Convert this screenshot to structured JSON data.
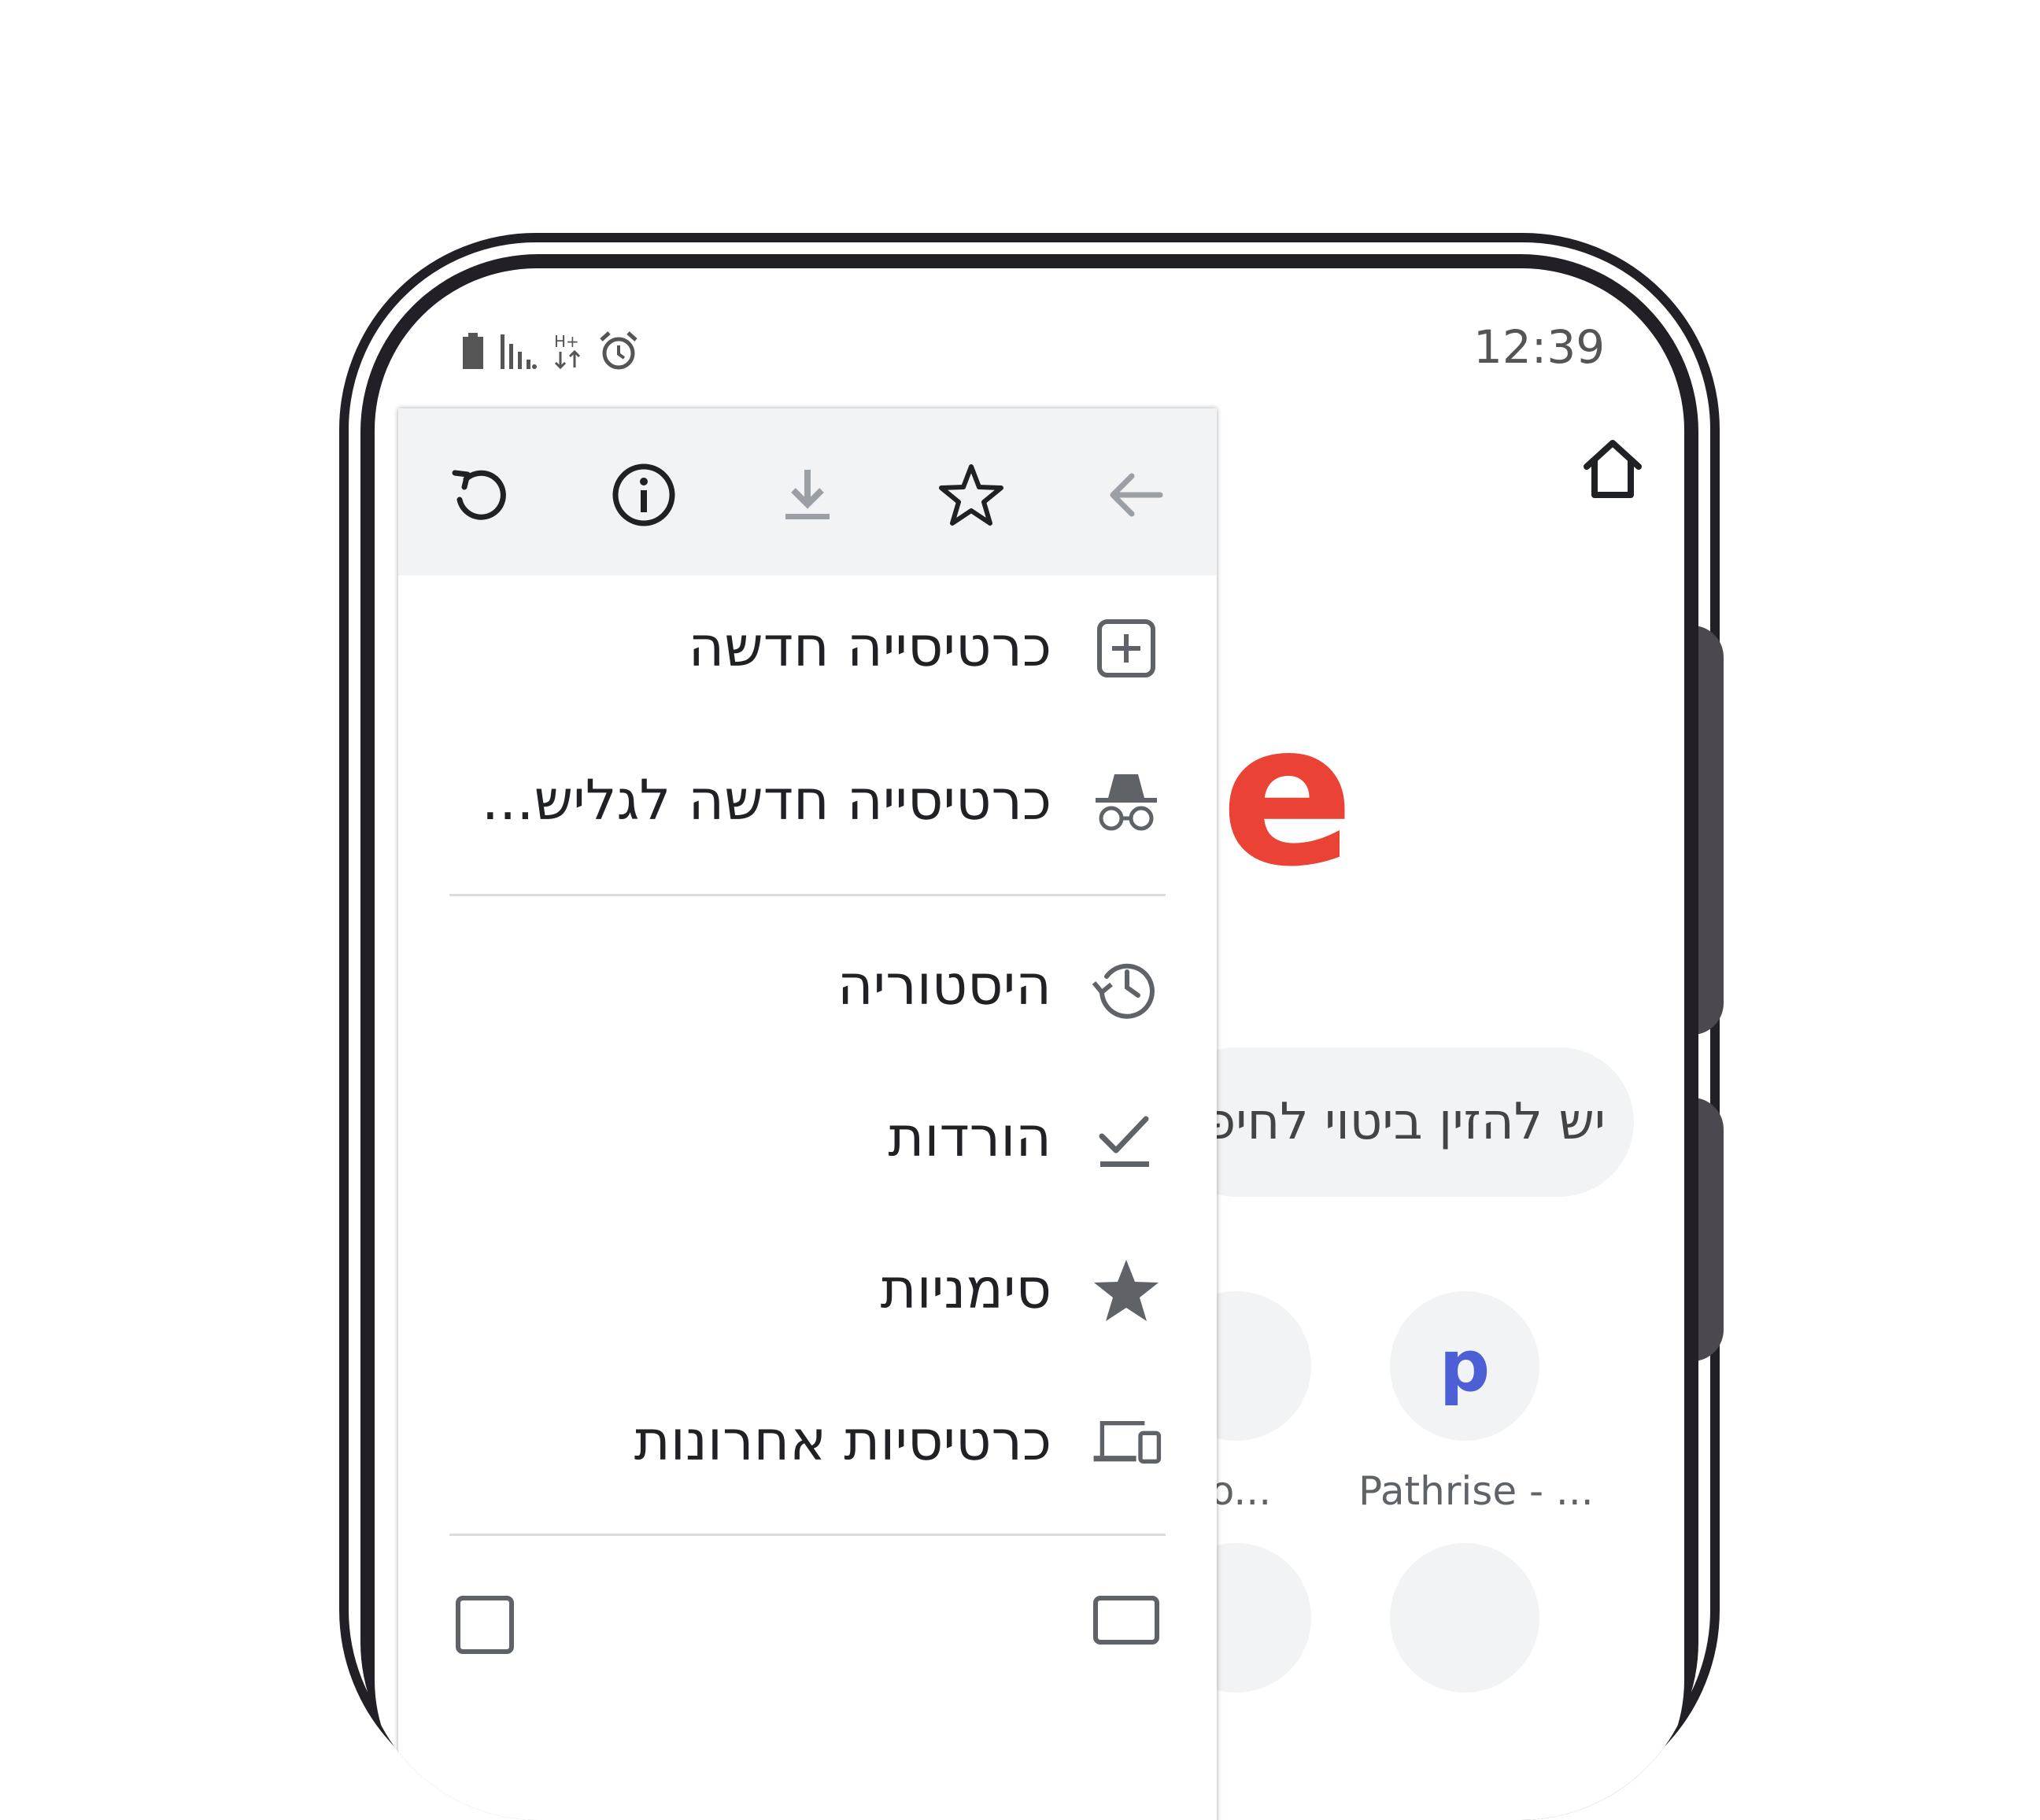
{
  "status_bar": {
    "time": "12:39",
    "icons": [
      "battery-icon",
      "signal-icon",
      "data-icon",
      "alarm-icon"
    ]
  },
  "toolbar": {
    "home_icon": "home-icon"
  },
  "background_page": {
    "logo_fragment": "e",
    "search_placeholder": "יש להזין ביטוי לחיפ",
    "shortcuts": [
      {
        "label": "ho...",
        "letter": ""
      },
      {
        "label": "Pathrise - ...",
        "letter": "p"
      }
    ]
  },
  "menu": {
    "top_actions": [
      "reload-icon",
      "info-icon",
      "download-icon",
      "star-icon",
      "back-icon"
    ],
    "items": [
      {
        "label": "כרטיסייה חדשה",
        "icon": "new-tab-icon"
      },
      {
        "label": "כרטיסייה חדשה לגליש...",
        "icon": "incognito-icon"
      },
      {
        "label": "היסטוריה",
        "icon": "history-icon"
      },
      {
        "label": "הורדות",
        "icon": "downloads-icon"
      },
      {
        "label": "סימניות",
        "icon": "bookmarks-icon"
      },
      {
        "label": "כרטיסיות אחרונות",
        "icon": "recent-tabs-icon"
      }
    ]
  },
  "colors": {
    "menu_toolbar_bg": "#f1f3f4",
    "icon_gray": "#5f6368",
    "logo_red": "#ea4335",
    "logo_green": "#34a853",
    "shortcut_blue": "#4c5fd5",
    "phone_frame": "#231f27"
  }
}
